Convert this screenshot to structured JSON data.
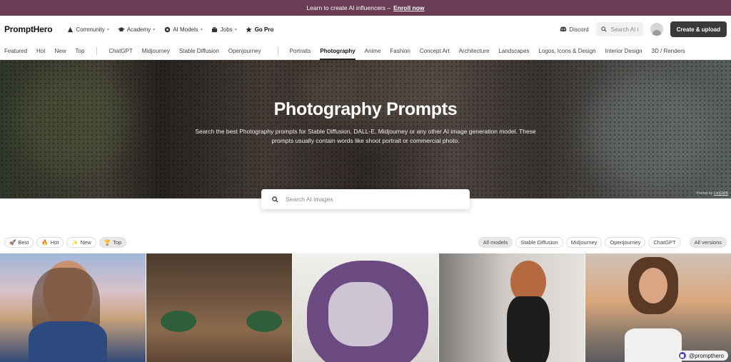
{
  "banner": {
    "text": "Learn to create AI influencers –",
    "link": "Enroll now"
  },
  "header": {
    "logo": "PromptHero",
    "nav": [
      {
        "label": "Community",
        "icon": "community-icon",
        "dropdown": true
      },
      {
        "label": "Academy",
        "icon": "academy-cap-icon",
        "dropdown": true
      },
      {
        "label": "AI Models",
        "icon": "ai-models-icon",
        "dropdown": true
      },
      {
        "label": "Jobs",
        "icon": "briefcase-icon",
        "dropdown": true
      },
      {
        "label": "Go Pro",
        "icon": "star-icon",
        "dropdown": false
      }
    ],
    "discord": "Discord",
    "search_placeholder": "Search AI i",
    "create_button": "Create & upload"
  },
  "categories": {
    "group1": [
      "Featured",
      "Hot",
      "New",
      "Top"
    ],
    "group2": [
      "ChatGPT",
      "Midjourney",
      "Stable Diffusion",
      "Openjourney"
    ],
    "group3": [
      "Portraits",
      "Photography",
      "Anime",
      "Fashion",
      "Concept Art",
      "Architecture",
      "Landscapes",
      "Logos, Icons & Design",
      "Interior Design",
      "3D / Renders"
    ],
    "active": "Photography"
  },
  "hero": {
    "title": "Photography Prompts",
    "description": "Search the best Photography prompts for Stable Diffusion, DALL-E, Midjourney or any other AI image generation model. These prompts usually contain words like shoot portrait or commercial photo.",
    "credit_prefix": "Prompt by",
    "credit_user": "LohGWB"
  },
  "search": {
    "placeholder": "Search AI images"
  },
  "sort_filters": [
    {
      "label": "Best",
      "icon": "rocket-icon",
      "selected": false
    },
    {
      "label": "Hot",
      "icon": "fire-icon",
      "selected": false
    },
    {
      "label": "New",
      "icon": "sparkles-icon",
      "selected": false
    },
    {
      "label": "Top",
      "icon": "trophy-icon",
      "selected": true
    }
  ],
  "model_filters": [
    {
      "label": "All models",
      "selected": true
    },
    {
      "label": "Stable Diffusion",
      "selected": false
    },
    {
      "label": "Midjourney",
      "selected": false
    },
    {
      "label": "Openjourney",
      "selected": false
    },
    {
      "label": "ChatGPT",
      "selected": false
    }
  ],
  "versions_filter": "All versions",
  "gallery": {
    "tag_user": "@prompthero"
  },
  "colors": {
    "banner": "#6b3d54",
    "create_button": "#3a3a3a"
  }
}
